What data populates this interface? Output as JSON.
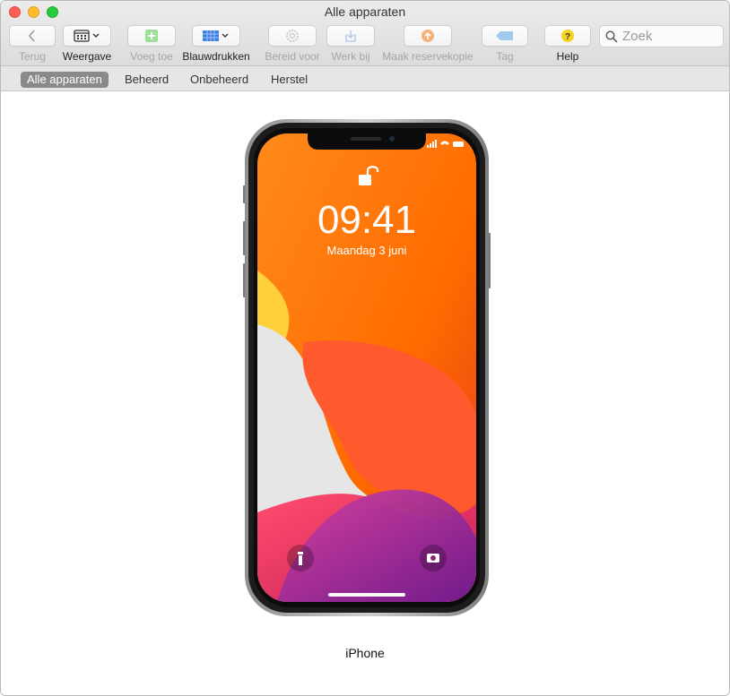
{
  "window": {
    "title": "Alle apparaten"
  },
  "toolbar": {
    "back": "Terug",
    "view": "Weergave",
    "add": "Voeg toe",
    "blueprints": "Blauwdrukken",
    "prepare": "Bereid voor",
    "update": "Werk bij",
    "backup": "Maak reservekopie",
    "tag": "Tag",
    "help": "Help"
  },
  "search": {
    "placeholder": "Zoek"
  },
  "scopes": [
    "Alle apparaten",
    "Beheerd",
    "Onbeheerd",
    "Herstel"
  ],
  "device": {
    "name": "iPhone",
    "lock_time": "09:41",
    "lock_date": "Maandag 3 juni"
  },
  "colors": {
    "accent": "#4a90e2",
    "add_green": "#8fd98f",
    "backup_orange": "#f4b183",
    "help_yellow": "#f7d21e",
    "tag_blue": "#9ec9f0"
  }
}
